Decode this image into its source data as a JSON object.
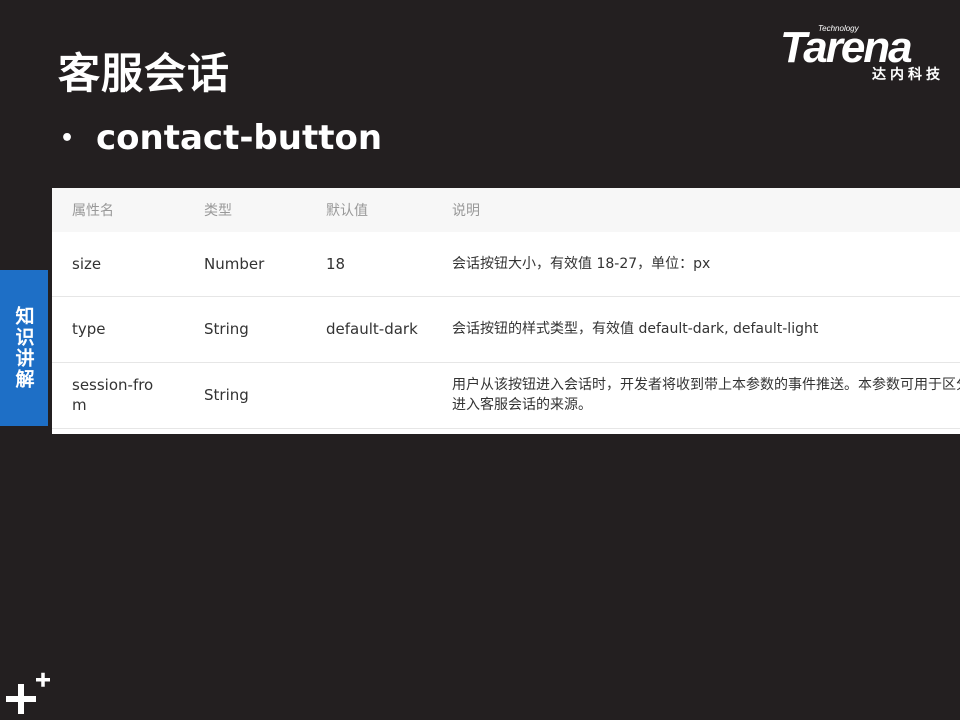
{
  "slide": {
    "title": "客服会话",
    "bullet_symbol": "•",
    "bullet_text": "contact-button",
    "side_tab": "知识讲解"
  },
  "logo": {
    "tech": "Technology",
    "word": "Tarena",
    "cn": "达内科技"
  },
  "table": {
    "headers": [
      "属性名",
      "类型",
      "默认值",
      "说明"
    ],
    "rows": [
      {
        "name": "size",
        "type": "Number",
        "default": "18",
        "desc": [
          "会话按钮大小，有效值 18-27，单位：px"
        ]
      },
      {
        "name": "type",
        "type": "String",
        "default": "default-dark",
        "desc": [
          "会话按钮的样式类型，有效值 default-dark, default-light"
        ]
      },
      {
        "name": "session-from",
        "type": "String",
        "default": "",
        "desc": [
          "用户从该按钮进入会话时，开发者将收到带上本参数的事件推送。本参数可用于区分用户",
          "进入客服会话的来源。"
        ]
      }
    ]
  },
  "colors": {
    "background": "#231f20",
    "side_tab": "#1e6fc6",
    "header_bg": "#f7f7f7"
  }
}
